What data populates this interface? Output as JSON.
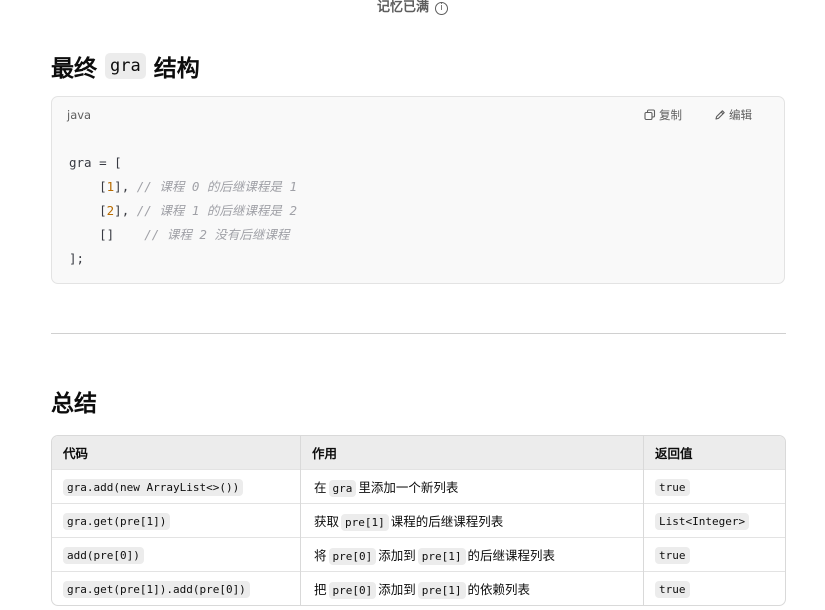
{
  "banner": {
    "text": "记忆已满",
    "info_glyph": "i"
  },
  "section1": {
    "title_prefix": "最终",
    "title_code": "gra",
    "title_suffix": "结构"
  },
  "code_block": {
    "language": "java",
    "copy_label": "复制",
    "edit_label": "编辑",
    "lines": [
      {
        "code": "gra = ["
      },
      {
        "indent": "    ",
        "open": "[",
        "num": "1",
        "close": "],",
        "gap": " ",
        "comment": "// 课程 0 的后继课程是 1"
      },
      {
        "indent": "    ",
        "open": "[",
        "num": "2",
        "close": "],",
        "gap": " ",
        "comment": "// 课程 1 的后继课程是 2"
      },
      {
        "indent": "    ",
        "open": "[]",
        "num": "",
        "close": "",
        "gap": "    ",
        "comment": "// 课程 2 没有后继课程"
      },
      {
        "code": "];"
      }
    ]
  },
  "section2": {
    "title": "总结"
  },
  "table": {
    "headers": [
      "代码",
      "作用",
      "返回值"
    ],
    "rows": [
      {
        "code": "gra.add(new ArrayList<>())",
        "effect": {
          "t1": "在",
          "c1": "gra",
          "t2": "里添加一个新列表",
          "c2": "",
          "t3": ""
        },
        "ret": "true"
      },
      {
        "code": "gra.get(pre[1])",
        "effect": {
          "t1": "获取",
          "c1": "pre[1]",
          "t2": "课程的后继课程列表",
          "c2": "",
          "t3": ""
        },
        "ret": "List<Integer>"
      },
      {
        "code": "add(pre[0])",
        "effect": {
          "t1": "将",
          "c1": "pre[0]",
          "t2": "添加到",
          "c2": "pre[1]",
          "t3": "的后继课程列表"
        },
        "ret": "true"
      },
      {
        "code": "gra.get(pre[1]).add(pre[0])",
        "effect": {
          "t1": "把",
          "c1": "pre[0]",
          "t2": "添加到",
          "c2": "pre[1]",
          "t3": "的依赖列表"
        },
        "ret": "true"
      }
    ]
  }
}
